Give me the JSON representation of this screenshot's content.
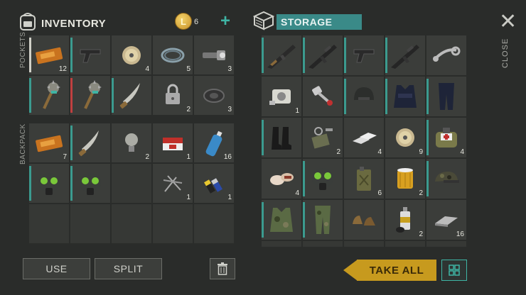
{
  "inventory": {
    "title": "INVENTORY",
    "coin_symbol": "L",
    "coin_count": "6",
    "add_label": "+",
    "pockets_label": "POCKETS",
    "backpack_label": "BACKPACK",
    "pockets": [
      {
        "icon": "coupon-icon",
        "count": "12",
        "bar": "#d0d0c8"
      },
      {
        "icon": "pistol-icon",
        "count": "",
        "bar": "#3b9b8f"
      },
      {
        "icon": "spool-icon",
        "count": "4",
        "bar": ""
      },
      {
        "icon": "wire-coil-icon",
        "count": "5",
        "bar": ""
      },
      {
        "icon": "flashlight-icon",
        "count": "3",
        "bar": ""
      },
      {
        "icon": "spiked-mace-icon",
        "count": "",
        "bar": "#3b9b8f"
      },
      {
        "icon": "spiked-mace-icon",
        "count": "",
        "bar": "#c04040"
      },
      {
        "icon": "machete-icon",
        "count": "",
        "bar": "#3b9b8f"
      },
      {
        "icon": "padlock-icon",
        "count": "2",
        "bar": ""
      },
      {
        "icon": "tape-roll-icon",
        "count": "3",
        "bar": ""
      }
    ],
    "backpack": [
      {
        "icon": "coupon-icon",
        "count": "7",
        "bar": ""
      },
      {
        "icon": "machete-icon",
        "count": "",
        "bar": "#3b9b8f"
      },
      {
        "icon": "lightbulb-icon",
        "count": "2",
        "bar": ""
      },
      {
        "icon": "cigarette-pack-icon",
        "count": "1",
        "bar": ""
      },
      {
        "icon": "water-bottle-icon",
        "count": "16",
        "bar": ""
      },
      {
        "icon": "gas-mask-icon",
        "count": "",
        "bar": "#3b9b8f"
      },
      {
        "icon": "gas-mask-icon",
        "count": "",
        "bar": "#3b9b8f"
      },
      {
        "icon": "",
        "count": "",
        "bar": ""
      },
      {
        "icon": "nails-icon",
        "count": "1",
        "bar": ""
      },
      {
        "icon": "batteries-icon",
        "count": "1",
        "bar": ""
      },
      {
        "icon": "",
        "count": "",
        "bar": ""
      },
      {
        "icon": "",
        "count": "",
        "bar": ""
      },
      {
        "icon": "",
        "count": "",
        "bar": ""
      },
      {
        "icon": "",
        "count": "",
        "bar": ""
      },
      {
        "icon": "",
        "count": "",
        "bar": ""
      }
    ],
    "use_label": "USE",
    "split_label": "SPLIT"
  },
  "storage": {
    "title": "STORAGE",
    "take_all_label": "TAKE ALL",
    "items": [
      {
        "icon": "ak-rifle-icon",
        "count": "",
        "bar": "#3b9b8f"
      },
      {
        "icon": "assault-rifle-icon",
        "count": "",
        "bar": "#3b9b8f"
      },
      {
        "icon": "pistol-icon",
        "count": "",
        "bar": "#3b9b8f"
      },
      {
        "icon": "assault-rifle-icon",
        "count": "",
        "bar": "#3b9b8f"
      },
      {
        "icon": "wrench-part-icon",
        "count": "",
        "bar": ""
      },
      {
        "icon": "engine-block-icon",
        "count": "1",
        "bar": ""
      },
      {
        "icon": "piston-icon",
        "count": "",
        "bar": ""
      },
      {
        "icon": "helmet-icon",
        "count": "",
        "bar": "#3b9b8f"
      },
      {
        "icon": "vest-icon",
        "count": "",
        "bar": "#3b9b8f"
      },
      {
        "icon": "pants-icon",
        "count": "",
        "bar": "#3b9b8f"
      },
      {
        "icon": "boots-icon",
        "count": "",
        "bar": "#3b9b8f"
      },
      {
        "icon": "scrap-parts-icon",
        "count": "2",
        "bar": ""
      },
      {
        "icon": "metal-bars-icon",
        "count": "4",
        "bar": ""
      },
      {
        "icon": "spool-icon",
        "count": "9",
        "bar": ""
      },
      {
        "icon": "medkit-bag-icon",
        "count": "4",
        "bar": "#3b9b8f"
      },
      {
        "icon": "bandage-icon",
        "count": "4",
        "bar": ""
      },
      {
        "icon": "gas-mask-icon",
        "count": "",
        "bar": "#3b9b8f"
      },
      {
        "icon": "jerrycan-icon",
        "count": "6",
        "bar": ""
      },
      {
        "icon": "oil-filter-icon",
        "count": "2",
        "bar": ""
      },
      {
        "icon": "camo-cap-icon",
        "count": "",
        "bar": "#3b9b8f"
      },
      {
        "icon": "camo-vest-icon",
        "count": "",
        "bar": "#3b9b8f"
      },
      {
        "icon": "camo-pants-icon",
        "count": "",
        "bar": "#3b9b8f"
      },
      {
        "icon": "shoes-icon",
        "count": "",
        "bar": ""
      },
      {
        "icon": "spray-can-icon",
        "count": "2",
        "bar": ""
      },
      {
        "icon": "steel-ingot-icon",
        "count": "16",
        "bar": ""
      }
    ]
  },
  "close_label": "CLOSE",
  "colors": {
    "accent": "#3fb5a5",
    "take_all": "#c79a1e",
    "storage_header": "#3a8a88"
  }
}
